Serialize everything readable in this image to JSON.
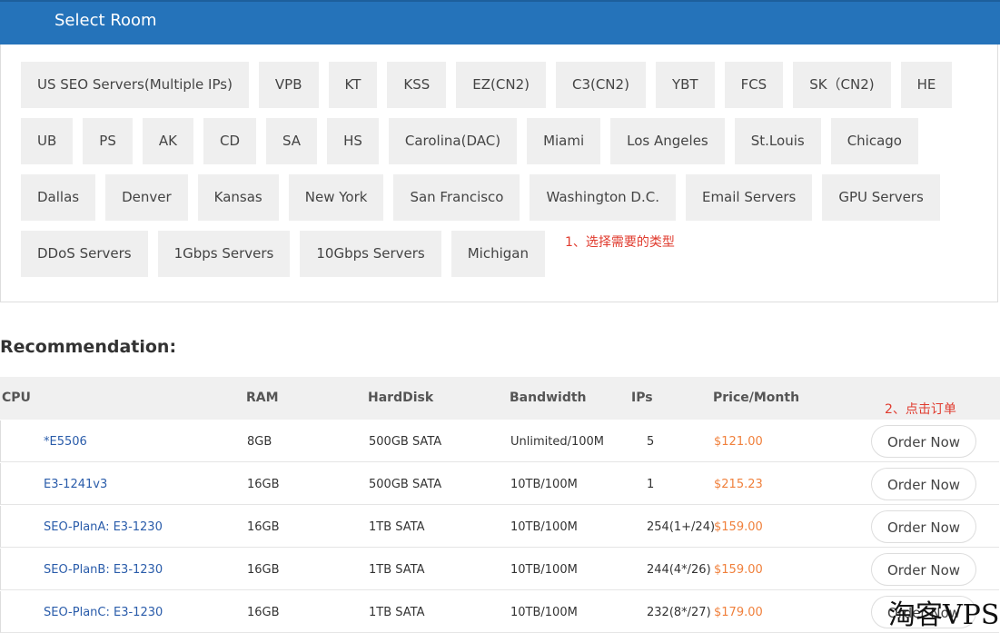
{
  "header": {
    "title": "Select Room"
  },
  "rooms": [
    [
      "US SEO Servers(Multiple IPs)",
      "VPB",
      "KT",
      "KSS",
      "EZ(CN2)",
      "C3(CN2)",
      "YBT",
      "FCS",
      "SK（CN2)",
      "HE"
    ],
    [
      "UB",
      "PS",
      "AK",
      "CD",
      "SA",
      "HS",
      "Carolina(DAC)",
      "Miami",
      "Los Angeles",
      "St.Louis",
      "Chicago"
    ],
    [
      "Dallas",
      "Denver",
      "Kansas",
      "New York",
      "San Francisco",
      "Washington D.C.",
      "Email Servers",
      "GPU Servers"
    ],
    [
      "DDoS Servers",
      "1Gbps Servers",
      "10Gbps Servers",
      "Michigan"
    ]
  ],
  "annotations": {
    "step1": "1、选择需要的类型",
    "step2": "2、点击订单"
  },
  "recommendation": {
    "title": "Recommendation:",
    "columns": [
      "CPU",
      "RAM",
      "HardDisk",
      "Bandwidth",
      "IPs",
      "Price/Month"
    ],
    "order_label": "Order Now",
    "rows": [
      [
        "*E5506",
        "8GB",
        "500GB SATA",
        "Unlimited/100M",
        "5",
        "$121.00"
      ],
      [
        "E3-1241v3",
        "16GB",
        "500GB SATA",
        "10TB/100M",
        "1",
        "$215.23"
      ],
      [
        "SEO-PlanA: E3-1230",
        "16GB",
        "1TB SATA",
        "10TB/100M",
        "254(1+/24)",
        "$159.00"
      ],
      [
        "SEO-PlanB: E3-1230",
        "16GB",
        "1TB SATA",
        "10TB/100M",
        "244(4*/26)",
        "$159.00"
      ],
      [
        "SEO-PlanC: E3-1230",
        "16GB",
        "1TB SATA",
        "10TB/100M",
        "232(8*/27)",
        "$179.00"
      ]
    ]
  },
  "watermark": "淘客VPS",
  "colors": {
    "header": "#2573ba",
    "price": "#f0803c",
    "link": "#2a5caa",
    "annotation": "#e03b2e"
  }
}
